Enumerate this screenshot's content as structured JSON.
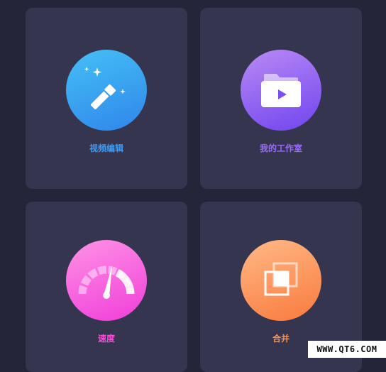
{
  "cards": [
    {
      "label": "视频编辑",
      "icon": "magic-wand-icon",
      "label_color": "#3f9af0"
    },
    {
      "label": "我的工作室",
      "icon": "video-folder-icon",
      "label_color": "#9a6bf6"
    },
    {
      "label": "速度",
      "icon": "speedometer-icon",
      "label_color": "#f352d6"
    },
    {
      "label": "合并",
      "icon": "merge-icon",
      "label_color": "#f9924f"
    }
  ],
  "watermark": "WWW.QT6.COM"
}
